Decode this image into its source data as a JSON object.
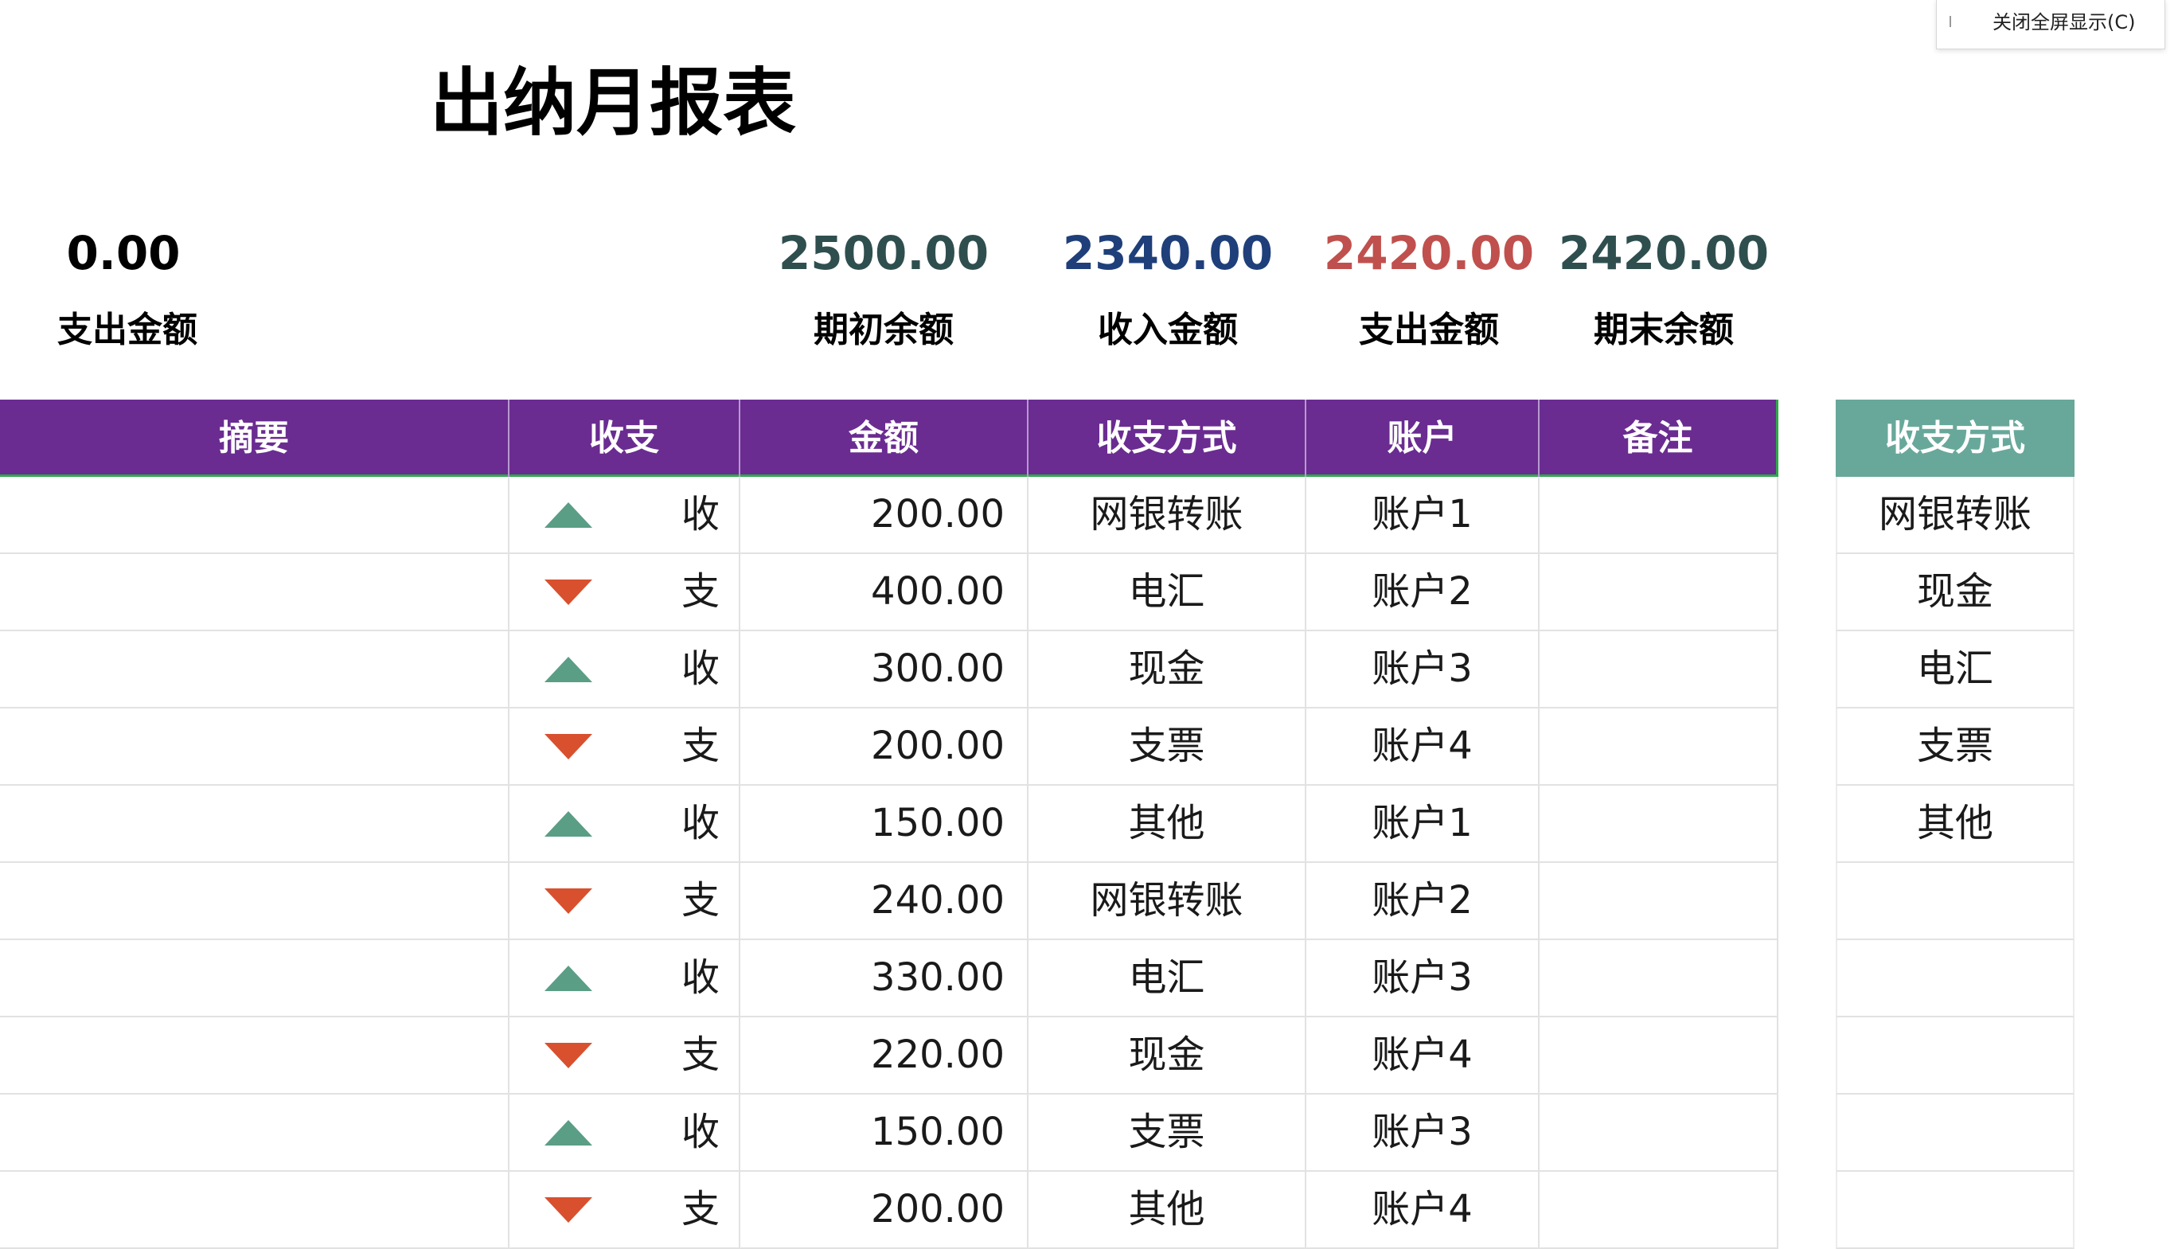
{
  "title": "出纳月报表",
  "summary_left": {
    "value": "0.00",
    "label": "支出金额",
    "color": "#111111"
  },
  "metrics": [
    {
      "value": "2500.00",
      "label": "期初余额",
      "color": "#2f4f4f"
    },
    {
      "value": "2340.00",
      "label": "收入金额",
      "color": "#1f3f7a"
    },
    {
      "value": "2420.00",
      "label": "支出金额",
      "color": "#c0504d"
    },
    {
      "value": "2420.00",
      "label": "期末余额",
      "color": "#2f4f4f"
    }
  ],
  "table": {
    "headers": [
      "摘要",
      "收支",
      "金额",
      "收支方式",
      "账户",
      "备注"
    ],
    "rows": [
      {
        "summary": "",
        "type": "收",
        "dir": "up",
        "amount": "200.00",
        "method": "网银转账",
        "account": "账户1",
        "note": ""
      },
      {
        "summary": "",
        "type": "支",
        "dir": "down",
        "amount": "400.00",
        "method": "电汇",
        "account": "账户2",
        "note": ""
      },
      {
        "summary": "",
        "type": "收",
        "dir": "up",
        "amount": "300.00",
        "method": "现金",
        "account": "账户3",
        "note": ""
      },
      {
        "summary": "",
        "type": "支",
        "dir": "down",
        "amount": "200.00",
        "method": "支票",
        "account": "账户4",
        "note": ""
      },
      {
        "summary": "",
        "type": "收",
        "dir": "up",
        "amount": "150.00",
        "method": "其他",
        "account": "账户1",
        "note": ""
      },
      {
        "summary": "",
        "type": "支",
        "dir": "down",
        "amount": "240.00",
        "method": "网银转账",
        "account": "账户2",
        "note": ""
      },
      {
        "summary": "",
        "type": "收",
        "dir": "up",
        "amount": "330.00",
        "method": "电汇",
        "account": "账户3",
        "note": ""
      },
      {
        "summary": "",
        "type": "支",
        "dir": "down",
        "amount": "220.00",
        "method": "现金",
        "account": "账户4",
        "note": ""
      },
      {
        "summary": "",
        "type": "收",
        "dir": "up",
        "amount": "150.00",
        "method": "支票",
        "account": "账户3",
        "note": ""
      },
      {
        "summary": "",
        "type": "支",
        "dir": "down",
        "amount": "200.00",
        "method": "其他",
        "account": "账户4",
        "note": ""
      }
    ]
  },
  "side_list": {
    "header": "收支方式",
    "items": [
      "网银转账",
      "现金",
      "电汇",
      "支票",
      "其他",
      "",
      "",
      "",
      "",
      ""
    ]
  },
  "popup": {
    "label": "关闭全屏显示(C)"
  },
  "colors": {
    "header_bg": "#6a2c91",
    "side_header_bg": "#68a89a",
    "up": "#5a9e86",
    "down": "#d8502e"
  }
}
